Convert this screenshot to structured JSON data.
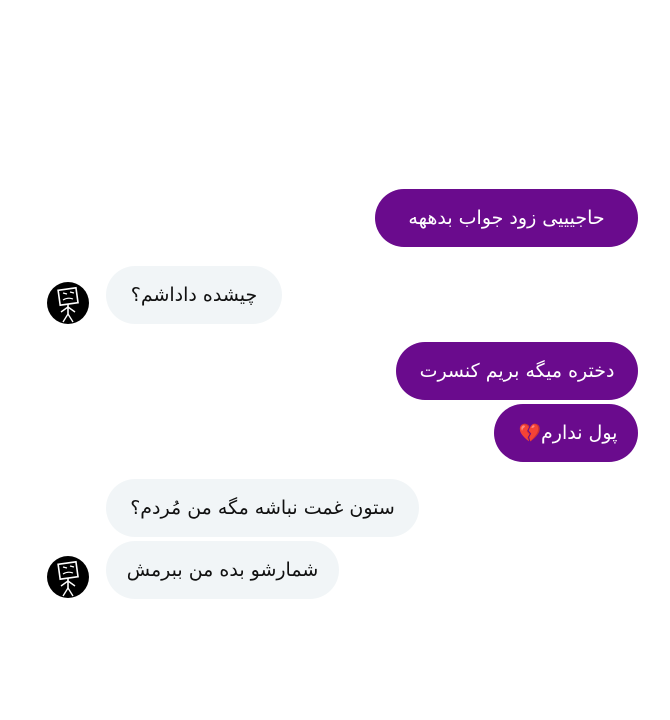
{
  "chat": {
    "messages": [
      {
        "sender": "self",
        "text": "حاجیییی زود جواب بدههه"
      },
      {
        "sender": "other",
        "text": "چیشده داداشم؟"
      },
      {
        "sender": "self",
        "text": "دختره میگه بریم کنسرت"
      },
      {
        "sender": "self",
        "text": "پول ندارم",
        "emoji": "💔"
      },
      {
        "sender": "other",
        "text": "ستون غمت نباشه مگه من مُردم؟"
      },
      {
        "sender": "other",
        "text": "شمارشو بده من ببرمش"
      }
    ],
    "avatar_icon": "stick-figure-avatar-icon",
    "colors": {
      "sent_bubble": "#6a0b8d",
      "received_bubble": "#f1f5f7",
      "background": "#ffffff"
    }
  }
}
